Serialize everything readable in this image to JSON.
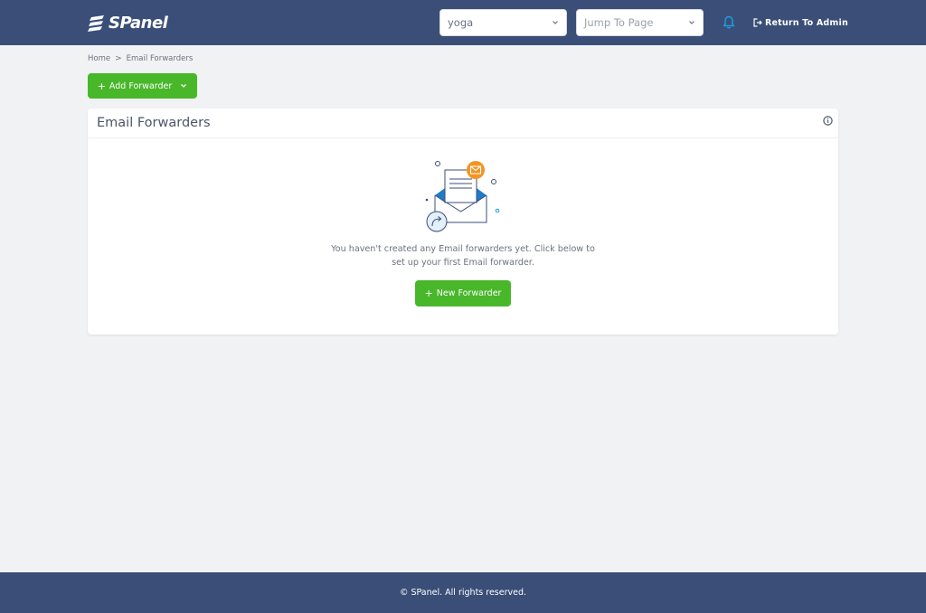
{
  "header": {
    "logo_text": "SPanel",
    "site_select": {
      "value": "yoga"
    },
    "jump_select": {
      "placeholder": "Jump To Page"
    },
    "return_admin_label": "Return To Admin"
  },
  "breadcrumb": {
    "items": [
      "Home",
      "Email Forwarders"
    ],
    "separator": ">"
  },
  "toolbar": {
    "add_forwarder_label": "Add Forwarder",
    "add_icon": "plus-icon",
    "dropdown_icon": "chevron-down-icon"
  },
  "card": {
    "title": "Email Forwarders",
    "empty_message": "You haven't created any Email forwarders yet. Click below to set up your first Email forwarder.",
    "new_forwarder_label": "New Forwarder"
  },
  "footer": {
    "copyright": "© SPanel. All rights reserved."
  },
  "colors": {
    "header_bg": "#3a4e78",
    "footer_bg": "#3a4e78",
    "page_bg": "#f1f2f4",
    "accent_green": "#48b72a",
    "bell_blue": "#1e9be0",
    "envelope_orange": "#f39423"
  }
}
